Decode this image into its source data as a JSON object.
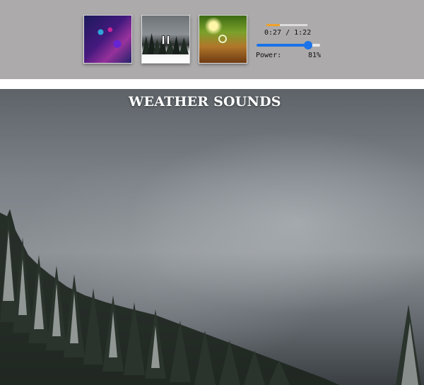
{
  "sounds": [
    {
      "name": "rain-city",
      "state": "idle"
    },
    {
      "name": "snow-forest",
      "state": "playing",
      "icon": "pause-icon"
    },
    {
      "name": "sunny-forest",
      "state": "idle",
      "icon": "target-icon"
    }
  ],
  "player": {
    "time": "0:27 / 1:22",
    "progress": 0.33,
    "power_label": "Power:",
    "power_value": "81%",
    "power": 0.81
  },
  "hero": {
    "title": "WEATHER SOUNDS"
  },
  "colors": {
    "top_bar": "#acaaaa",
    "progress": "#f0a02a",
    "slider": "#1a73e8"
  }
}
